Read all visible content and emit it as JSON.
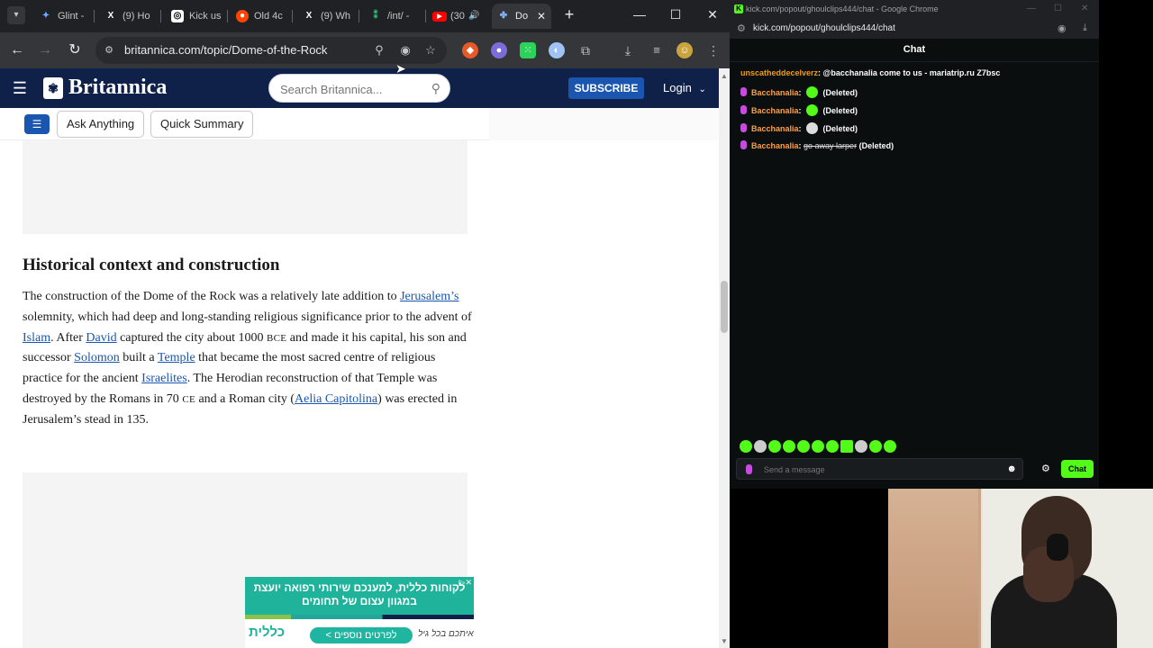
{
  "browser_left": {
    "tabs": [
      {
        "label": "Glint -",
        "favicon": "glint-icon",
        "active": false
      },
      {
        "label": "(9) Ho",
        "favicon": "x-icon",
        "active": false
      },
      {
        "label": "Kick us",
        "favicon": "kick-icon",
        "active": false
      },
      {
        "label": "Old 4c",
        "favicon": "reddit-icon",
        "active": false
      },
      {
        "label": "(9) Wh",
        "favicon": "x-icon",
        "active": false
      },
      {
        "label": "/int/ -",
        "favicon": "4chan-icon",
        "active": false
      },
      {
        "label": "(30",
        "favicon": "youtube-icon",
        "active": false
      },
      {
        "label": "Do",
        "favicon": "britannica-icon",
        "active": true
      }
    ],
    "url": "britannica.com/topic/Dome-of-the-Rock"
  },
  "britannica": {
    "logo": "Britannica",
    "search_placeholder": "Search Britannica...",
    "subscribe": "SUBSCRIBE",
    "login": "Login",
    "ask_anything": "Ask Anything",
    "quick_summary": "Quick Summary",
    "section_heading": "Historical context and construction",
    "paragraph": [
      {
        "t": "text",
        "v": "The construction of the Dome of the Rock was a relatively late addition to "
      },
      {
        "t": "link",
        "v": "Jerusalem’s"
      },
      {
        "t": "text",
        "v": " solemnity, which had deep and long-standing religious significance prior to the advent of "
      },
      {
        "t": "link",
        "v": "Islam"
      },
      {
        "t": "text",
        "v": ". After "
      },
      {
        "t": "link",
        "v": "David"
      },
      {
        "t": "text",
        "v": " captured the city about 1000 "
      },
      {
        "t": "sc",
        "v": "BCE"
      },
      {
        "t": "text",
        "v": " and made it his capital, his son and successor "
      },
      {
        "t": "link",
        "v": "Solomon"
      },
      {
        "t": "text",
        "v": " built a "
      },
      {
        "t": "link",
        "v": "Temple"
      },
      {
        "t": "text",
        "v": " that became the most sacred centre of religious practice for the ancient "
      },
      {
        "t": "link",
        "v": "Israelites"
      },
      {
        "t": "text",
        "v": ". The Herodian reconstruction of that Temple was destroyed by the Romans in 70 "
      },
      {
        "t": "sc",
        "v": "CE"
      },
      {
        "t": "text",
        "v": " and a Roman city ("
      },
      {
        "t": "link",
        "v": "Aelia Capitolina"
      },
      {
        "t": "text",
        "v": ") was erected in Jerusalem’s stead in 135."
      }
    ],
    "ad": {
      "headline": "לקוחות כללית, למענכם שירותי רפואה יועצת במגוון עצום של תחומים",
      "logo": "כללית",
      "cta": "לפרטים נוספים >",
      "tagline": "איתכם בכל גיל"
    }
  },
  "browser_right": {
    "title": "kick.com/popout/ghoulclips444/chat - Google Chrome",
    "url": "kick.com/popout/ghoulclips444/chat",
    "chat_header": "Chat",
    "messages": [
      {
        "user": "unscatheddecelverz",
        "text": "@bacchanalia come to us - mariatrip.ru Z7bsc"
      },
      {
        "user": "Bacchanalia",
        "text": "(Deleted)"
      },
      {
        "user": "Bacchanalia",
        "text": "(Deleted)"
      },
      {
        "user": "Bacchanalia",
        "text": "(Deleted)"
      },
      {
        "user": "Bacchanalia",
        "strike": "go away larper",
        "text": "(Deleted)"
      }
    ],
    "input_placeholder": "Send a message",
    "send_label": "Chat"
  }
}
